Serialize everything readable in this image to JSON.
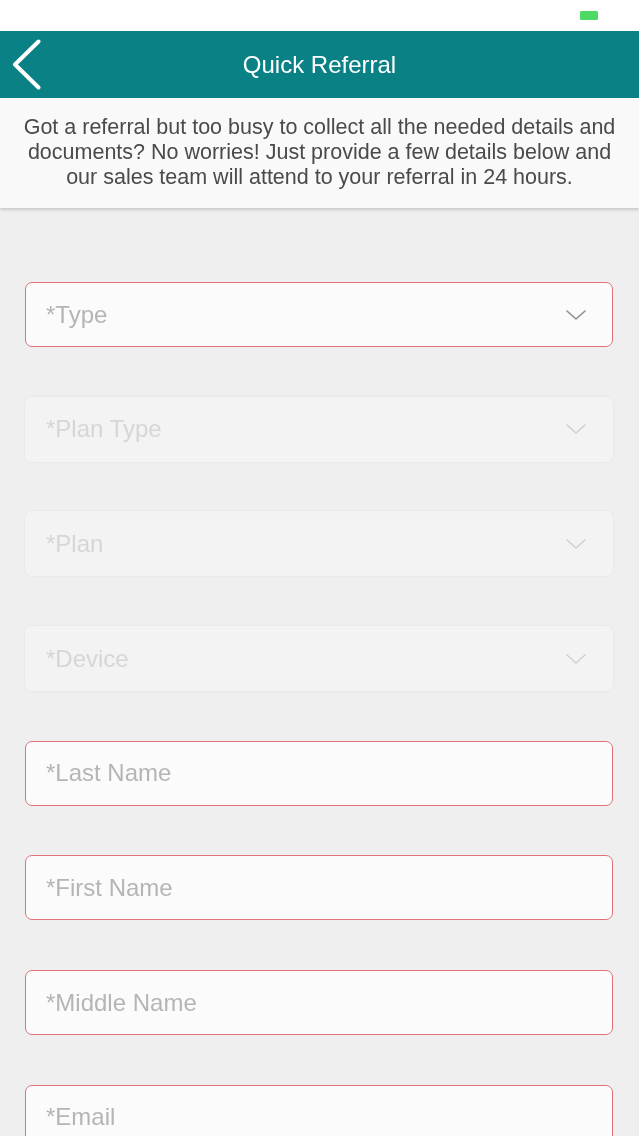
{
  "header": {
    "title": "Quick Referral"
  },
  "intro": "Got a referral but too busy to collect all the needed details and documents? No worries! Just provide a few details below and our sales team will attend to your referral in 24 hours.",
  "fields": [
    {
      "kind": "select",
      "placeholder": "*Type",
      "disabled": false,
      "invalid": true
    },
    {
      "kind": "select",
      "placeholder": "*Plan Type",
      "disabled": true,
      "invalid": false
    },
    {
      "kind": "select",
      "placeholder": "*Plan",
      "disabled": true,
      "invalid": false
    },
    {
      "kind": "select",
      "placeholder": "*Device",
      "disabled": true,
      "invalid": false
    },
    {
      "kind": "text",
      "placeholder": "*Last Name",
      "disabled": false,
      "invalid": true
    },
    {
      "kind": "text",
      "placeholder": "*First Name",
      "disabled": false,
      "invalid": true
    },
    {
      "kind": "text",
      "placeholder": "*Middle Name",
      "disabled": false,
      "invalid": true
    },
    {
      "kind": "text",
      "placeholder": "*Email",
      "disabled": false,
      "invalid": true
    }
  ]
}
